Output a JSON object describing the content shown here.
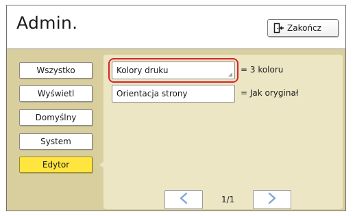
{
  "header": {
    "title": "Admin.",
    "exit_label": "Zakończ",
    "exit_icon": "door-exit-icon"
  },
  "sidebar": {
    "items": [
      {
        "label": "Wszystko",
        "active": false
      },
      {
        "label": "Wyświetl",
        "active": false
      },
      {
        "label": "Domyślny",
        "active": false
      },
      {
        "label": "System",
        "active": false
      },
      {
        "label": "Edytor",
        "active": true
      }
    ],
    "active_color": "#ffe53d"
  },
  "settings": [
    {
      "label": "Kolory druku",
      "value": "= 3 koloru",
      "highlighted": true
    },
    {
      "label": "Orientacja strony",
      "value": "= Jak oryginał",
      "highlighted": false
    }
  ],
  "pager": {
    "text": "1/1",
    "prev_icon": "chevron-left-icon",
    "next_icon": "chevron-right-icon"
  },
  "colors": {
    "background": "#d9cf9e",
    "panel": "#ece6c4",
    "highlight": "#d8232a",
    "chevron": "#7ea6d8"
  }
}
